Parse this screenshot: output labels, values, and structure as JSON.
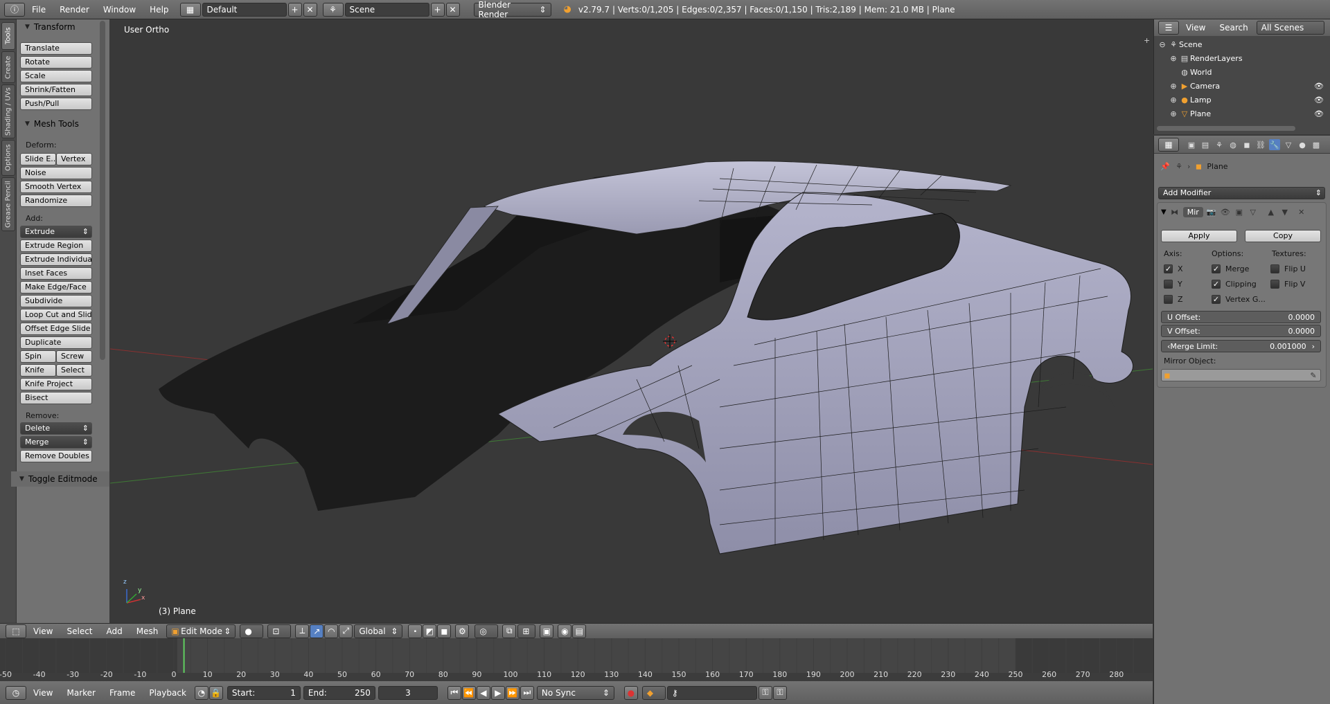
{
  "topbar": {
    "menus": [
      "File",
      "Render",
      "Window",
      "Help"
    ],
    "layout": "Default",
    "scene": "Scene",
    "engine": "Blender Render",
    "stats": "v2.79.7 | Verts:0/1,205 | Edges:0/2,357 | Faces:0/1,150 | Tris:2,189 | Mem: 21.0 MB | Plane"
  },
  "tabs": [
    "Tools",
    "Create",
    "Shading / UVs",
    "Options",
    "Grease Pencil"
  ],
  "toolshelf": {
    "transform_title": "Transform",
    "transform": [
      "Translate",
      "Rotate",
      "Scale",
      "Shrink/Fatten",
      "Push/Pull"
    ],
    "mesh_tools_title": "Mesh Tools",
    "deform_label": "Deform:",
    "slide_edge": "Slide E...",
    "vertex": "Vertex",
    "noise": "Noise",
    "smooth_vertex": "Smooth Vertex",
    "randomize": "Randomize",
    "add_label": "Add:",
    "extrude": "Extrude",
    "add_items": [
      "Extrude Region",
      "Extrude Individual",
      "Inset Faces",
      "Make Edge/Face",
      "Subdivide",
      "Loop Cut and Slide",
      "Offset Edge Slide",
      "Duplicate"
    ],
    "spin": "Spin",
    "screw": "Screw",
    "knife": "Knife",
    "select": "Select",
    "knife_project": "Knife Project",
    "bisect": "Bisect",
    "remove_label": "Remove:",
    "delete": "Delete",
    "merge": "Merge",
    "remove_doubles": "Remove Doubles",
    "toggle_editmode": "Toggle Editmode"
  },
  "viewport": {
    "view_label": "User Ortho",
    "object_label": "(3) Plane",
    "axis_x": "x",
    "axis_y": "y",
    "axis_z": "z"
  },
  "vpheader": {
    "menus": [
      "View",
      "Select",
      "Add",
      "Mesh"
    ],
    "mode": "Edit Mode",
    "orientation": "Global"
  },
  "timeline": {
    "ticks": [
      "-50",
      "-40",
      "-30",
      "-20",
      "-10",
      "0",
      "10",
      "20",
      "30",
      "40",
      "50",
      "60",
      "70",
      "80",
      "90",
      "100",
      "110",
      "120",
      "130",
      "140",
      "150",
      "160",
      "170",
      "180",
      "190",
      "200",
      "210",
      "220",
      "230",
      "240",
      "250",
      "260",
      "270",
      "280"
    ],
    "current_frame": 3,
    "menus": [
      "View",
      "Marker",
      "Frame",
      "Playback"
    ],
    "start_label": "Start:",
    "start": "1",
    "end_label": "End:",
    "end": "250",
    "frame": "3",
    "sync": "No Sync"
  },
  "outliner": {
    "menus": [
      "View",
      "Search"
    ],
    "filter": "All Scenes",
    "items": [
      "Scene",
      "RenderLayers",
      "World",
      "Camera",
      "Lamp",
      "Plane"
    ]
  },
  "properties": {
    "breadcrumb": "Plane",
    "add_modifier": "Add Modifier",
    "modifier_name": "Mir",
    "apply": "Apply",
    "copy": "Copy",
    "axis_label": "Axis:",
    "options_label": "Options:",
    "textures_label": "Textures:",
    "axis": [
      {
        "label": "X",
        "checked": true
      },
      {
        "label": "Y",
        "checked": false
      },
      {
        "label": "Z",
        "checked": false
      }
    ],
    "options": [
      {
        "label": "Merge",
        "checked": true
      },
      {
        "label": "Clipping",
        "checked": true
      },
      {
        "label": "Vertex G...",
        "checked": true
      }
    ],
    "textures": [
      {
        "label": "Flip U",
        "checked": false
      },
      {
        "label": "Flip V",
        "checked": false
      }
    ],
    "u_offset_label": "U Offset:",
    "u_offset": "0.0000",
    "v_offset_label": "V Offset:",
    "v_offset": "0.0000",
    "merge_limit_label": "Merge Limit:",
    "merge_limit": "0.001000",
    "mirror_object_label": "Mirror Object:"
  },
  "colors": {
    "accent": "#5680c2",
    "timeline_cursor": "#60d060",
    "grid_red": "#9a3535",
    "grid_green": "#4a8a3a",
    "mesh": "#9a9ab4"
  }
}
